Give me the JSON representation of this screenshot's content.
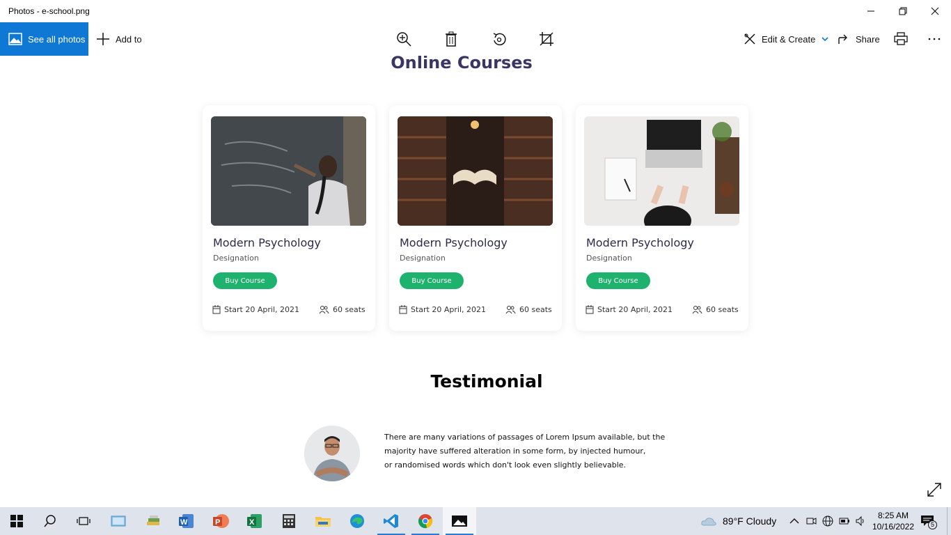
{
  "window": {
    "title": "Photos - e-school.png"
  },
  "toolbar": {
    "see_all_label": "See all photos",
    "add_to_label": "Add to",
    "edit_create_label": "Edit & Create",
    "share_label": "Share"
  },
  "page": {
    "courses_title": "Online Courses",
    "courses": [
      {
        "title": "Modern Psychology",
        "designation": "Designation",
        "button": "Buy Course",
        "start": "Start 20  April, 2021",
        "seats": "60 seats"
      },
      {
        "title": "Modern Psychology",
        "designation": "Designation",
        "button": "Buy Course",
        "start": "Start 20  April, 2021",
        "seats": "60 seats"
      },
      {
        "title": "Modern Psychology",
        "designation": "Designation",
        "button": "Buy Course",
        "start": "Start 20  April, 2021",
        "seats": "60 seats"
      }
    ],
    "testimonial_title": "Testimonial",
    "testimonial_lines": [
      "There are many variations of passages of Lorem Ipsum available, but the",
      " majority have suffered alteration in some form, by injected humour,",
      "or randomised words which don't look even slightly believable."
    ]
  },
  "taskbar": {
    "weather": "89°F  Cloudy",
    "time": "8:25 AM",
    "date": "10/16/2022",
    "notification_count": "5"
  }
}
